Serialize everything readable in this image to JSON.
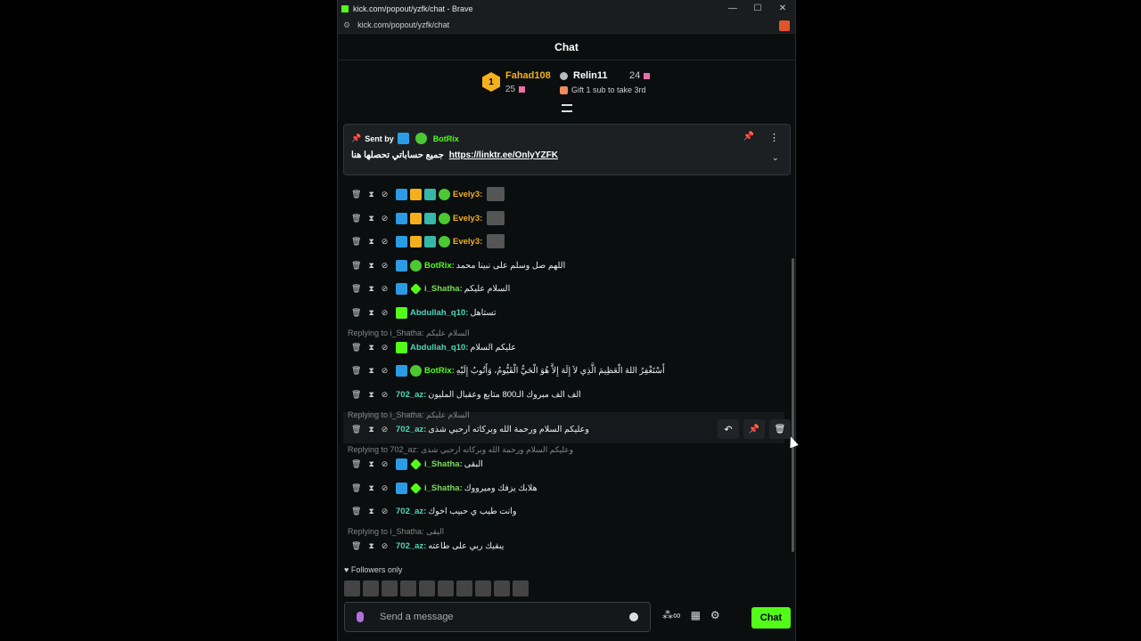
{
  "window": {
    "title": "kick.com/popout/yzfk/chat - Brave",
    "url": "kick.com/popout/yzfk/chat",
    "controls": [
      "—",
      "☐",
      "✕"
    ]
  },
  "chat": {
    "title": "Chat"
  },
  "leaderboard": {
    "first": {
      "rank": "1",
      "name": "Fahad108",
      "count": "25"
    },
    "second": {
      "name": "Relin11",
      "count": "24"
    },
    "third": {
      "text": "Gift 1 sub to take 3rd"
    }
  },
  "pinned": {
    "label": "Sent by",
    "name": "BotRix",
    "text": "جميع حساباتي تحصلها هنا",
    "link": "https://linktr.ee/OnlyYZFK"
  },
  "messages": [
    {
      "name": "Evely3:",
      "text": "",
      "color": "c-gold",
      "emote": true
    },
    {
      "name": "Evely3:",
      "text": "",
      "color": "c-gold",
      "emote": true
    },
    {
      "name": "Evely3:",
      "text": "",
      "color": "c-gold",
      "emote": true
    },
    {
      "name": "BotRix:",
      "text": "اللهم صل وسلم على نبينا محمد",
      "color": "c-green"
    },
    {
      "name": "i_Shatha:",
      "text": "السلام عليكم",
      "color": "c-l"
    },
    {
      "name": "Abdullah_q10:",
      "text": "تستاهل",
      "color": "c-teal"
    },
    {
      "reply": "Replying to i_Shatha: السلام عليكم"
    },
    {
      "name": "Abdullah_q10:",
      "text": "عليكم السلام",
      "color": "c-teal"
    },
    {
      "name": "BotRix:",
      "text": "أَسْتَغْفِرُ اللهَ الْعَظِيمَ الَّذِي لاَ إِلَهَ إِلاَّ هُوَ الْحَيُّ الْقَيُّومُ، وَأَتُوبُ إِلَيْهِ",
      "color": "c-green"
    },
    {
      "name": "702_az:",
      "text": "الف الف مبروك الـ800 متابع وعقبال المليون",
      "color": "c-teal"
    },
    {
      "reply": "Replying to i_Shatha: السلام عليكم"
    },
    {
      "name": "702_az:",
      "text": "وعليكم السلام ورحمة الله وبركاته ارحبي شذى",
      "color": "c-teal"
    },
    {
      "reply": "Replying to 702_az: وعليكم السلام ورحمة الله وبركاته ارحبي شذى"
    },
    {
      "name": "i_Shatha:",
      "text": "البقى",
      "color": "c-l"
    },
    {
      "name": "i_Shatha:",
      "text": "هلابك يزفك وميرووك",
      "color": "c-l"
    },
    {
      "name": "702_az:",
      "text": "وانت طيب ي حبيب اخوك",
      "color": "c-teal"
    },
    {
      "reply": "Replying to i_Shatha: البقى"
    },
    {
      "name": "702_az:",
      "text": "يبقيك ربي على طاعته",
      "color": "c-teal"
    }
  ],
  "footer": {
    "followers": "Followers only",
    "placeholder": "Send a message",
    "send": "Chat"
  }
}
